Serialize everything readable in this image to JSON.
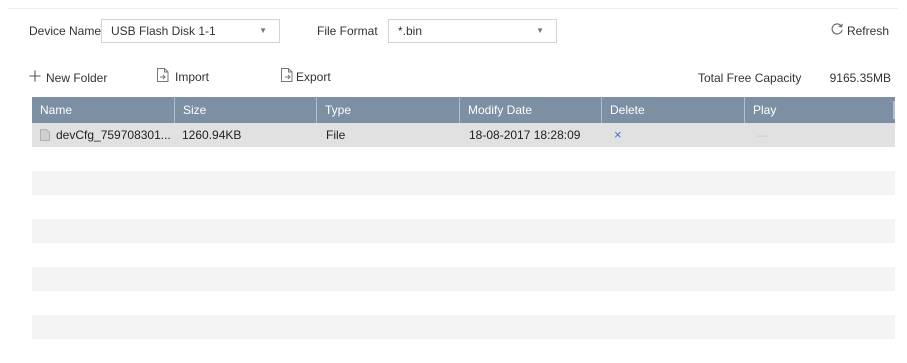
{
  "top": {
    "device_label": "Device Name",
    "device_value": "USB Flash Disk 1-1",
    "format_label": "File Format",
    "format_value": "*.bin",
    "refresh_label": "Refresh"
  },
  "toolbar": {
    "new_folder": "New Folder",
    "import": "Import",
    "export": "Export",
    "capacity_label": "Total Free Capacity",
    "capacity_value": "9165.35MB"
  },
  "table": {
    "columns": [
      "Name",
      "Size",
      "Type",
      "Modify Date",
      "Delete",
      "Play"
    ],
    "rows": [
      {
        "name": "devCfg_759708301...",
        "size": "1260.94KB",
        "type": "File",
        "date": "18-08-2017 18:28:09",
        "delete": "×",
        "play": "—"
      }
    ]
  },
  "colors": {
    "header_bg": "#7d8fa3",
    "selected_row": "#e1e1e1",
    "delete_icon": "#3a78c9"
  },
  "icons": [
    "refresh-icon",
    "plus-icon",
    "import-icon",
    "export-icon",
    "file-icon",
    "chevron-down-icon"
  ]
}
